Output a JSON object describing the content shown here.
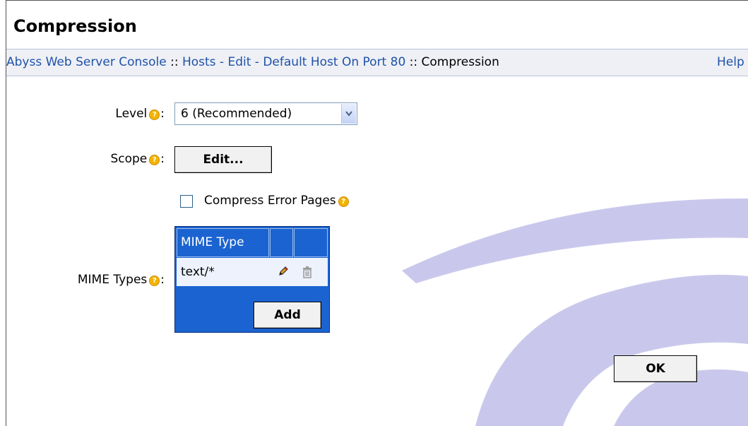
{
  "page": {
    "title": "Compression",
    "help_label": "Help"
  },
  "breadcrumb": {
    "console": "Abyss Web Server Console",
    "sep1": " :: ",
    "hosts": "Hosts - Edit - Default Host On Port 80",
    "sep2": " :: ",
    "current": "Compression"
  },
  "form": {
    "level_label": "Level",
    "level_value": "6 (Recommended)",
    "scope_label": "Scope",
    "scope_button": "Edit...",
    "compress_error_pages_label": "Compress Error Pages",
    "compress_error_pages_checked": false,
    "mime_label": "MIME Types",
    "colon": ":",
    "help_glyph": "?"
  },
  "mime_table": {
    "column_header": "MIME Type",
    "rows": [
      {
        "value": "text/*"
      }
    ],
    "add_button": "Add"
  },
  "actions": {
    "ok_button": "OK"
  },
  "colors": {
    "link": "#1f52a8",
    "table_blue": "#1b63d0",
    "decor_circle": "#c9c8ec",
    "help_icon": "#f4b400"
  },
  "icons": {
    "help": "help-icon",
    "edit": "pencil-icon",
    "delete": "trash-icon",
    "dropdown": "chevron-down-icon"
  }
}
